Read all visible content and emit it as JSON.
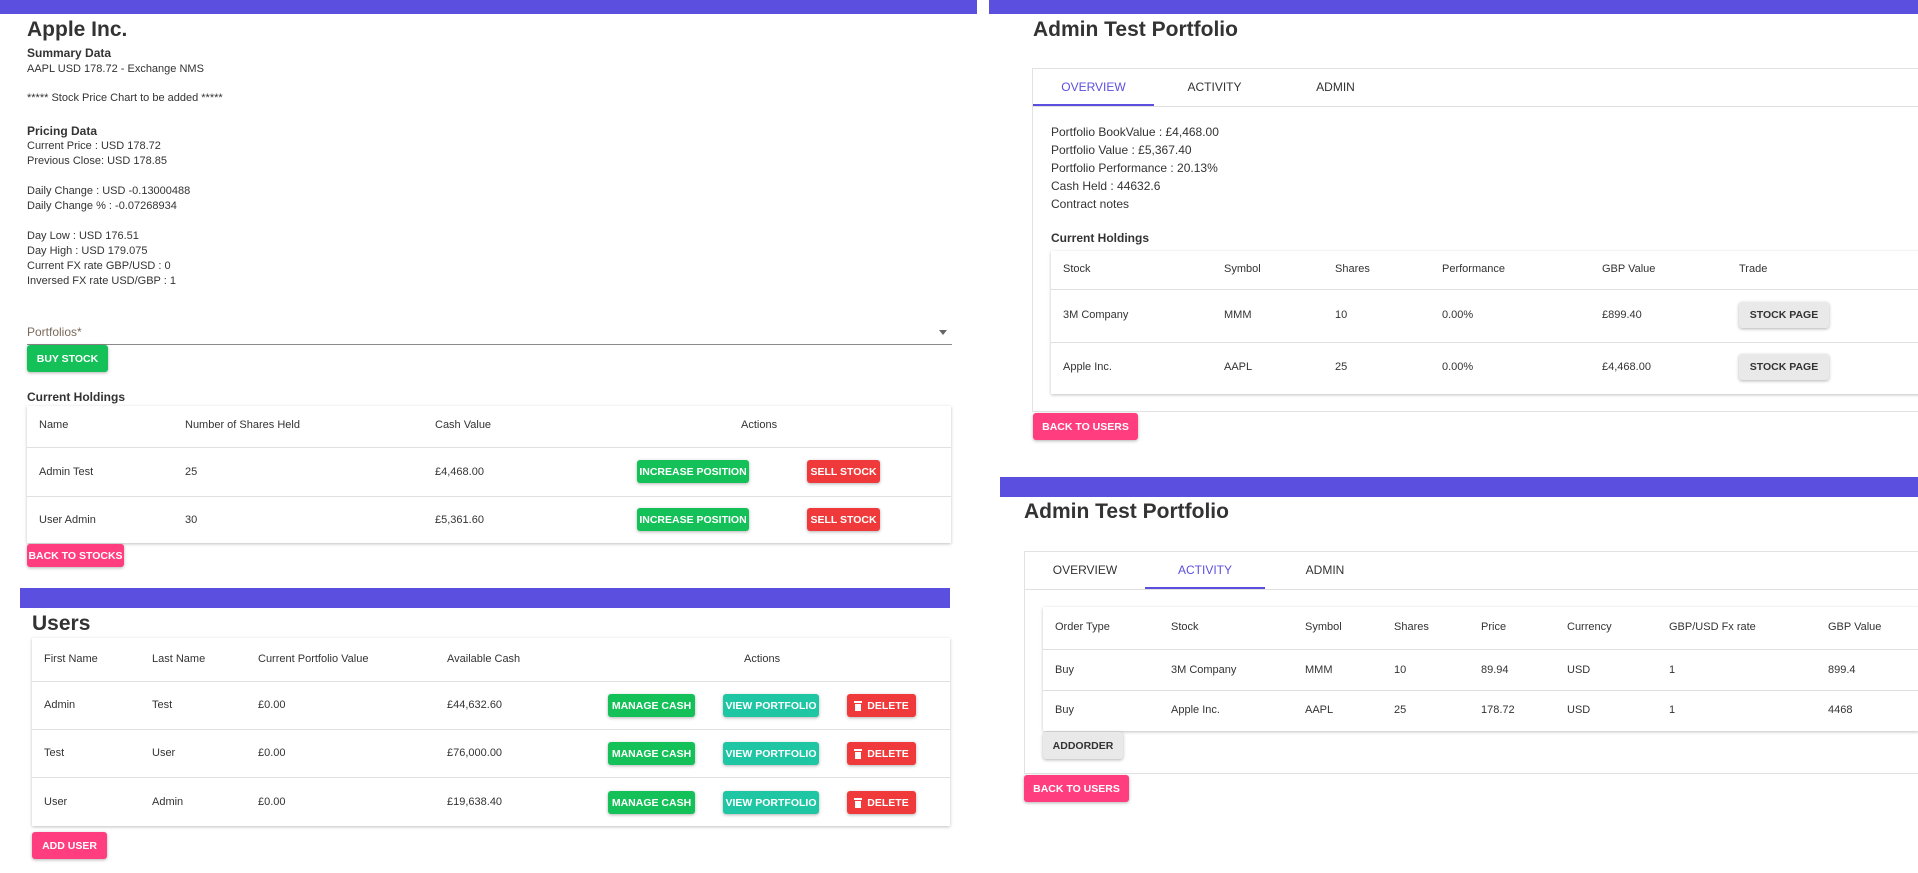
{
  "stock": {
    "title": "Apple Inc.",
    "summary_heading": "Summary Data",
    "summary_line": "AAPL USD 178.72 - Exchange NMS",
    "chart_note": "***** Stock Price Chart to be added *****",
    "pricing_heading": "Pricing Data",
    "pricing_lines": [
      "Current Price : USD 178.72",
      "Previous Close: USD 178.85",
      "Daily Change : USD -0.13000488",
      "Daily Change % : -0.07268934",
      "Day Low : USD 176.51",
      "Day High : USD 179.075",
      "Current FX rate GBP/USD : 0",
      "Inversed FX rate USD/GBP : 1"
    ],
    "portfolios_label": "Portfolios*",
    "buy_label": "BUY STOCK",
    "holdings_heading": "Current Holdings",
    "holdings_columns": [
      "Name",
      "Number of Shares Held",
      "Cash Value",
      "Actions"
    ],
    "holdings_rows": [
      {
        "name": "Admin Test",
        "shares": "25",
        "value": "£4,468.00"
      },
      {
        "name": "User Admin",
        "shares": "30",
        "value": "£5,361.60"
      }
    ],
    "increase_label": "INCREASE POSITION",
    "sell_label": "SELL STOCK",
    "back_label": "BACK TO STOCKS"
  },
  "users": {
    "title": "Users",
    "columns": [
      "First Name",
      "Last Name",
      "Current Portfolio Value",
      "Available Cash",
      "Actions"
    ],
    "rows": [
      {
        "first": "Admin",
        "last": "Test",
        "portfolio": "£0.00",
        "cash": "£44,632.60"
      },
      {
        "first": "Test",
        "last": "User",
        "portfolio": "£0.00",
        "cash": "£76,000.00"
      },
      {
        "first": "User",
        "last": "Admin",
        "portfolio": "£0.00",
        "cash": "£19,638.40"
      }
    ],
    "manage_label": "MANAGE CASH",
    "view_label": "VIEW PORTFOLIO",
    "delete_label": "DELETE",
    "add_label": "ADD USER"
  },
  "overview": {
    "title": "Admin Test Portfolio",
    "tabs": [
      "OVERVIEW",
      "ACTIVITY",
      "ADMIN"
    ],
    "lines": [
      "Portfolio BookValue : £4,468.00",
      "Portfolio Value : £5,367.40",
      "Portfolio Performance : 20.13%",
      "Cash Held : 44632.6",
      "Contract notes"
    ],
    "holdings_heading": "Current Holdings",
    "columns": [
      "Stock",
      "Symbol",
      "Shares",
      "Performance",
      "GBP Value",
      "Trade"
    ],
    "rows": [
      {
        "stock": "3M Company",
        "symbol": "MMM",
        "shares": "10",
        "performance": "0.00%",
        "value": "£899.40"
      },
      {
        "stock": "Apple Inc.",
        "symbol": "AAPL",
        "shares": "25",
        "performance": "0.00%",
        "value": "£4,468.00"
      }
    ],
    "stock_page_label": "STOCK PAGE",
    "back_label": "BACK TO USERS"
  },
  "activity": {
    "title": "Admin Test Portfolio",
    "tabs": [
      "OVERVIEW",
      "ACTIVITY",
      "ADMIN"
    ],
    "columns": [
      "Order Type",
      "Stock",
      "Symbol",
      "Shares",
      "Price",
      "Currency",
      "GBP/USD Fx rate",
      "GBP Value"
    ],
    "rows": [
      {
        "type": "Buy",
        "stock": "3M Company",
        "symbol": "MMM",
        "shares": "10",
        "price": "89.94",
        "currency": "USD",
        "fx": "1",
        "value": "899.4"
      },
      {
        "type": "Buy",
        "stock": "Apple Inc.",
        "symbol": "AAPL",
        "shares": "25",
        "price": "178.72",
        "currency": "USD",
        "fx": "1",
        "value": "4468"
      }
    ],
    "add_order_label": "ADDORDER",
    "back_label": "BACK TO USERS"
  },
  "colors": {
    "accent": "#5b4fe0",
    "green": "#14c158",
    "red": "#f0393a",
    "pink": "#ff3d7f",
    "teal": "#1fc6a3"
  }
}
